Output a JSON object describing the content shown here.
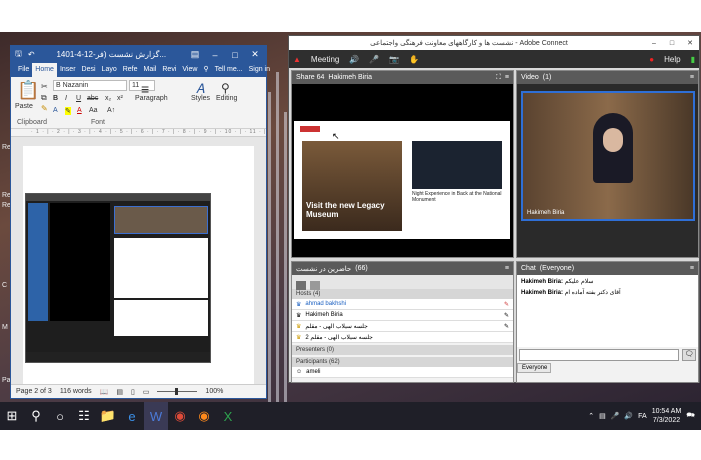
{
  "desktop": {
    "labels": [
      "Re",
      "Re",
      "Re",
      "C",
      "M",
      "Pa"
    ]
  },
  "word": {
    "title": "1401-4-12-گزارش نشست (فر...",
    "tabs": [
      "File",
      "Home",
      "Inser",
      "Desi",
      "Layo",
      "Refe",
      "Mail",
      "Revi",
      "View"
    ],
    "tell_me": "Tell me...",
    "sign_in": "Sign in",
    "font_name": "B Nazanin",
    "font_size": "11",
    "paste_label": "Paste",
    "paragraph_label": "Paragraph",
    "styles_label": "Styles",
    "editing_label": "Editing",
    "clipboard_label": "Clipboard",
    "font_label": "Font",
    "status": {
      "page": "Page 2 of 3",
      "words": "116 words",
      "zoom": "100%"
    }
  },
  "adobe": {
    "title": "نشست ها و کارگاههای معاونت فرهنگی واجتماعی - Adobe Connect",
    "meeting_menu": "Meeting",
    "help_menu": "Help",
    "share_pod": {
      "title": "Share 64",
      "presenter": "Hakimeh Biria"
    },
    "shared_page": {
      "headline": "Visit the new Legacy Museum",
      "caption": "Night Experience in Back at the National Monument"
    },
    "video_pod": {
      "title": "Video",
      "count": "(1)",
      "name": "Hakimeh Biria"
    },
    "attendees_pod": {
      "title": "حاضرین در نشست",
      "count": "(66)",
      "hosts_header": "Hosts (4)",
      "hosts": [
        "ahmad bakhshi",
        "Hakimeh Biria",
        "جلسه سیلاب الهی - مقلم",
        "جلسه سیلاب الهی - مقلم 2"
      ],
      "presenters_header": "Presenters (0)",
      "participants_header": "Participants (62)",
      "participants": [
        "ameli"
      ]
    },
    "chat_pod": {
      "title": "Chat",
      "scope": "(Everyone)",
      "messages": [
        {
          "sender": "Hakimeh Biria:",
          "text": "سلام علیکم"
        },
        {
          "sender": "Hakimeh Biria:",
          "text": "آقای دکتر بفته آماده ام"
        }
      ],
      "tab": "Everyone"
    }
  },
  "taskbar": {
    "time": "10:54 AM",
    "date": "7/3/2022",
    "lang": "FA"
  }
}
